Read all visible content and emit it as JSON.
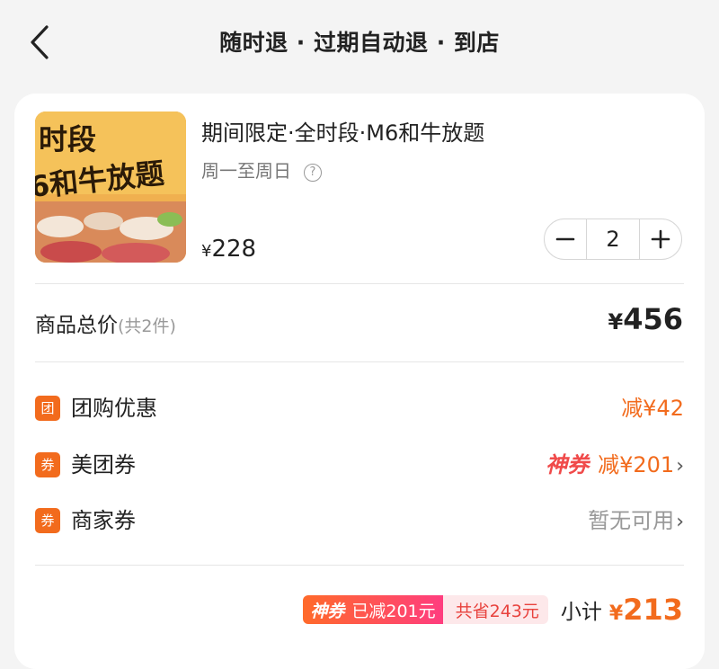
{
  "header": {
    "title": "随时退 · 过期自动退 · 到店"
  },
  "product": {
    "name": "期间限定·全时段·M6和牛放题",
    "subtitle": "周一至周日",
    "price_symbol": "¥",
    "price": "228",
    "quantity": "2",
    "thumb_text": [
      "时段",
      "6和牛放题"
    ]
  },
  "summary": {
    "label": "商品总价",
    "count_note": "(共2件)",
    "total_symbol": "¥",
    "total": "456"
  },
  "discounts": [
    {
      "badge": "团",
      "label": "团购优惠",
      "value": "减¥42"
    },
    {
      "badge": "券",
      "label": "美团券",
      "tag": "神券",
      "value": "减¥201"
    },
    {
      "badge": "券",
      "label": "商家券",
      "value": "暂无可用"
    }
  ],
  "footer": {
    "tag": "神券",
    "reduced": "已减201元",
    "saved": "共省243元",
    "subtotal_label": "小计",
    "subtotal_symbol": "¥",
    "subtotal": "213"
  },
  "colors": {
    "accent": "#f26b1d",
    "pink": "#ff3d7f"
  }
}
